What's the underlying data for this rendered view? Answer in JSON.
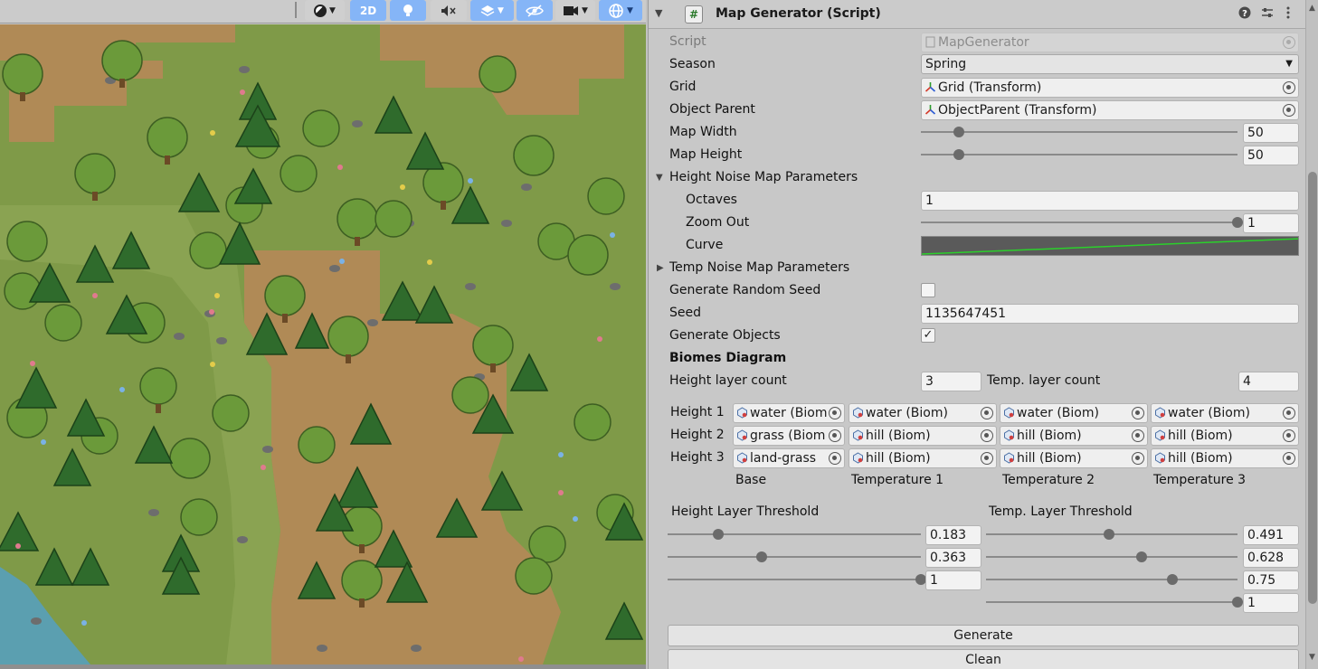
{
  "scene_toolbar": {
    "shading_icon": "sphere-shading-icon",
    "mode_2d_label": "2D",
    "lighting_icon": "light-bulb-icon",
    "audio_icon": "audio-mute-icon",
    "effects_icon": "effects-layers-icon",
    "hidden_icon": "eye-slash-icon",
    "camera_icon": "camera-icon",
    "gizmos_icon": "gizmo-globe-icon"
  },
  "component": {
    "title": "Map Generator (Script)",
    "help_icon": "help-icon",
    "preset_icon": "preset-sliders-icon",
    "menu_icon": "kebab-menu-icon"
  },
  "fields": {
    "script_label": "Script",
    "script_value": "MapGenerator",
    "season_label": "Season",
    "season_value": "Spring",
    "grid_label": "Grid",
    "grid_value": "Grid (Transform)",
    "object_parent_label": "Object Parent",
    "object_parent_value": "ObjectParent (Transform)",
    "map_width_label": "Map Width",
    "map_width_value": "50",
    "map_width_slider": 0.12,
    "map_height_label": "Map Height",
    "map_height_value": "50",
    "map_height_slider": 0.12,
    "height_noise_label": "Height Noise Map Parameters",
    "octaves_label": "Octaves",
    "octaves_value": "1",
    "zoom_out_label": "Zoom Out",
    "zoom_out_value": "1",
    "zoom_out_slider": 1.0,
    "curve_label": "Curve",
    "temp_noise_label": "Temp Noise Map Parameters",
    "gen_random_seed_label": "Generate Random Seed",
    "gen_random_seed_checked": false,
    "seed_label": "Seed",
    "seed_value": "1135647451",
    "gen_objects_label": "Generate Objects",
    "gen_objects_checked": true
  },
  "biomes": {
    "title": "Biomes Diagram",
    "height_layer_count_label": "Height layer count",
    "height_layer_count": "3",
    "temp_layer_count_label": "Temp. layer count",
    "temp_layer_count": "4",
    "rows": [
      {
        "label": "Height 1",
        "cells": [
          "water (Biom",
          "water (Biom)",
          "water (Biom)",
          "water (Biom)"
        ]
      },
      {
        "label": "Height 2",
        "cells": [
          "grass (Biom",
          "hill (Biom)",
          "hill (Biom)",
          "hill (Biom)"
        ]
      },
      {
        "label": "Height 3",
        "cells": [
          "land-grass",
          "hill (Biom)",
          "hill (Biom)",
          "hill (Biom)"
        ]
      }
    ],
    "columns": [
      "Base",
      "Temperature 1",
      "Temperature 2",
      "Temperature 3"
    ]
  },
  "thresholds": {
    "height_title": "Height Layer Threshold",
    "temp_title": "Temp. Layer Threshold",
    "height": [
      {
        "value": "0.183",
        "pos": 0.2
      },
      {
        "value": "0.363",
        "pos": 0.37
      },
      {
        "value": "1",
        "pos": 1.0
      }
    ],
    "temp": [
      {
        "value": "0.491",
        "pos": 0.49
      },
      {
        "value": "0.628",
        "pos": 0.62
      },
      {
        "value": "0.75",
        "pos": 0.74
      },
      {
        "value": "1",
        "pos": 1.0
      }
    ]
  },
  "buttons": {
    "generate": "Generate",
    "clean": "Clean"
  },
  "colors": {
    "accent_blue": "#85b5f7",
    "curve_green": "#2bd02b",
    "grass": "#7f9a48",
    "path": "#b08a56",
    "tree_dark": "#2f6b2c",
    "tree_light": "#6b9a3a",
    "water": "#5b9fb0"
  }
}
